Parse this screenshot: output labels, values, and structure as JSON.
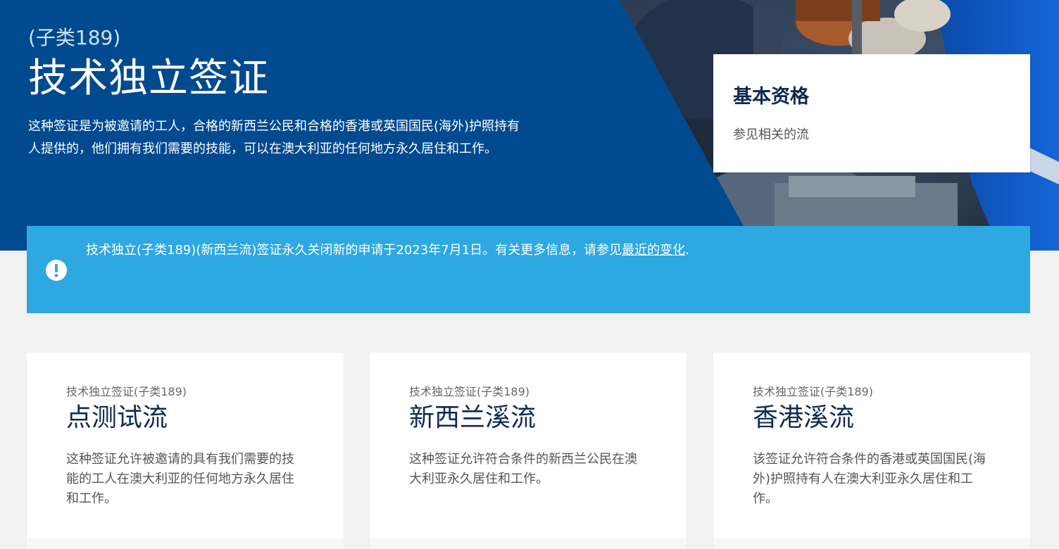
{
  "hero": {
    "subclass": "(子类189)",
    "title": "技术独立签证",
    "description": "这种签证是为被邀请的工人，合格的新西兰公民和合格的香港或英国国民(海外)护照持有人提供的，他们拥有我们需要的技能，可以在澳大利亚的任何地方永久居住和工作。",
    "eligibility": {
      "title": "基本资格",
      "text": "参见相关的流"
    }
  },
  "alert": {
    "icon": "exclamation-circle-icon",
    "text": "技术独立(子类189)(新西兰流)签证永久关闭新的申请于2023年7月1日。有关更多信息，请参见",
    "link": "最近的变化",
    "suffix": "."
  },
  "streams": [
    {
      "kicker": "技术独立签证(子类189)",
      "title": "点测试流",
      "description": "这种签证允许被邀请的具有我们需要的技能的工人在澳大利亚的任何地方永久居住和工作。"
    },
    {
      "kicker": "技术独立签证(子类189)",
      "title": "新西兰溪流",
      "description": "这种签证允许符合条件的新西兰公民在澳大利亚永久居住和工作。"
    },
    {
      "kicker": "技术独立签证(子类189)",
      "title": "香港溪流",
      "description": "该签证允许符合条件的香港或英国国民(海外)护照持有人在澳大利亚永久居住和工作。"
    }
  ],
  "colors": {
    "hero_blue": "#014a8f",
    "alert_blue": "#2ea8e1",
    "heading_navy": "#0e2a52"
  }
}
